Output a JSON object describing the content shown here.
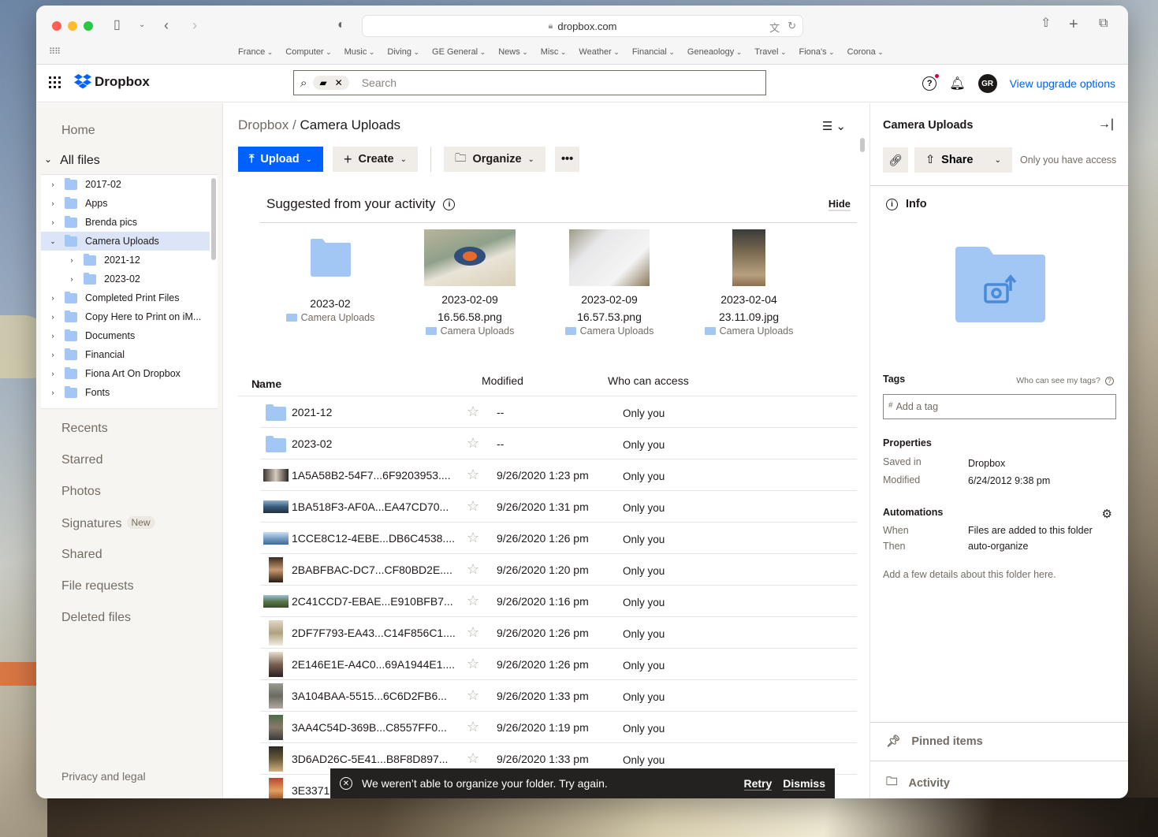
{
  "browser": {
    "url": "dropbox.com",
    "bookmarks": [
      "France",
      "Computer",
      "Music",
      "Diving",
      "GE General",
      "News",
      "Misc",
      "Weather",
      "Financial",
      "Geneaology",
      "Travel",
      "Fiona's",
      "Corona"
    ]
  },
  "header": {
    "brand": "Dropbox",
    "search_placeholder": "Search",
    "avatar_initials": "GR",
    "upgrade_link": "View upgrade options"
  },
  "sidebar": {
    "home": "Home",
    "all_files": "All files",
    "tree": [
      {
        "label": "2017-02",
        "level": 0,
        "expanded": false,
        "selected": false
      },
      {
        "label": "Apps",
        "level": 0,
        "expanded": false,
        "selected": false
      },
      {
        "label": "Brenda pics",
        "level": 0,
        "expanded": false,
        "selected": false
      },
      {
        "label": "Camera Uploads",
        "level": 0,
        "expanded": true,
        "selected": true
      },
      {
        "label": "2021-12",
        "level": 1,
        "expanded": false,
        "selected": false
      },
      {
        "label": "2023-02",
        "level": 1,
        "expanded": false,
        "selected": false
      },
      {
        "label": "Completed Print Files",
        "level": 0,
        "expanded": false,
        "selected": false
      },
      {
        "label": "Copy Here to Print on iM...",
        "level": 0,
        "expanded": false,
        "selected": false
      },
      {
        "label": "Documents",
        "level": 0,
        "expanded": false,
        "selected": false
      },
      {
        "label": "Financial",
        "level": 0,
        "expanded": false,
        "selected": false
      },
      {
        "label": "Fiona Art On Dropbox",
        "level": 0,
        "expanded": false,
        "selected": false
      },
      {
        "label": "Fonts",
        "level": 0,
        "expanded": false,
        "selected": false
      }
    ],
    "nav": [
      "Recents",
      "Starred",
      "Photos",
      "Signatures",
      "Shared",
      "File requests",
      "Deleted files"
    ],
    "signatures_badge": "New",
    "footer": "Privacy and legal"
  },
  "main": {
    "breadcrumb_root": "Dropbox",
    "breadcrumb_sep": "/",
    "breadcrumb_current": "Camera Uploads",
    "toolbar": {
      "upload": "Upload",
      "create": "Create",
      "organize": "Organize",
      "more": "•••"
    },
    "suggested": {
      "title": "Suggested from your activity",
      "hide": "Hide",
      "items": [
        {
          "line1": "2023-02",
          "line2": "",
          "location": "Camera Uploads",
          "kind": "folder"
        },
        {
          "line1": "2023-02-09",
          "line2": "16.56.58.png",
          "location": "Camera Uploads",
          "kind": "image"
        },
        {
          "line1": "2023-02-09",
          "line2": "16.57.53.png",
          "location": "Camera Uploads",
          "kind": "image"
        },
        {
          "line1": "2023-02-04",
          "line2": "23.11.09.jpg",
          "location": "Camera Uploads",
          "kind": "image"
        }
      ]
    },
    "columns": {
      "name": "Name",
      "sort_icon": "↑",
      "modified": "Modified",
      "access": "Who can access"
    },
    "rows": [
      {
        "name": "2021-12",
        "modified": "--",
        "access": "Only you",
        "kind": "folder"
      },
      {
        "name": "2023-02",
        "modified": "--",
        "access": "Only you",
        "kind": "folder"
      },
      {
        "name": "1A5A58B2-54F7...6F9203953....",
        "modified": "9/26/2020 1:23 pm",
        "access": "Only you",
        "kind": "image"
      },
      {
        "name": "1BA518F3-AF0A...EA47CD70...",
        "modified": "9/26/2020 1:31 pm",
        "access": "Only you",
        "kind": "image"
      },
      {
        "name": "1CCE8C12-4EBE...DB6C4538....",
        "modified": "9/26/2020 1:26 pm",
        "access": "Only you",
        "kind": "image"
      },
      {
        "name": "2BABFBAC-DC7...CF80BD2E....",
        "modified": "9/26/2020 1:20 pm",
        "access": "Only you",
        "kind": "image"
      },
      {
        "name": "2C41CCD7-EBAE...E910BFB7...",
        "modified": "9/26/2020 1:16 pm",
        "access": "Only you",
        "kind": "image"
      },
      {
        "name": "2DF7F793-EA43...C14F856C1....",
        "modified": "9/26/2020 1:26 pm",
        "access": "Only you",
        "kind": "image"
      },
      {
        "name": "2E146E1E-A4C0...69A1944E1....",
        "modified": "9/26/2020 1:26 pm",
        "access": "Only you",
        "kind": "image"
      },
      {
        "name": "3A104BAA-5515...6C6D2FB6...",
        "modified": "9/26/2020 1:33 pm",
        "access": "Only you",
        "kind": "image"
      },
      {
        "name": "3AA4C54D-369B...C8557FF0...",
        "modified": "9/26/2020 1:19 pm",
        "access": "Only you",
        "kind": "image"
      },
      {
        "name": "3D6AD26C-5E41...B8F8D897...",
        "modified": "9/26/2020 1:33 pm",
        "access": "Only you",
        "kind": "image"
      },
      {
        "name": "3E3371",
        "modified": "",
        "access": "",
        "kind": "image"
      }
    ]
  },
  "toast": {
    "message": "We weren’t able to organize your folder. Try again.",
    "retry": "Retry",
    "dismiss": "Dismiss"
  },
  "info_panel": {
    "title": "Camera Uploads",
    "share": "Share",
    "access_note": "Only you have access",
    "info_heading": "Info",
    "tags_heading": "Tags",
    "tags_help": "Who can see my tags?",
    "tag_placeholder": "Add a tag",
    "properties_heading": "Properties",
    "saved_in_label": "Saved in",
    "saved_in_value": "Dropbox",
    "modified_label": "Modified",
    "modified_value": "6/24/2012 9:38 pm",
    "automations_heading": "Automations",
    "when_label": "When",
    "when_value": "Files are added to this folder",
    "then_label": "Then",
    "then_value": "auto-organize",
    "description_placeholder": "Add a few details about this folder here.",
    "pinned": "Pinned items",
    "activity": "Activity"
  },
  "colors": {
    "accent": "#0061fe",
    "folder": "#a2c7f5",
    "selected_bg": "#dbe5f7",
    "toast_bg": "#242221"
  }
}
